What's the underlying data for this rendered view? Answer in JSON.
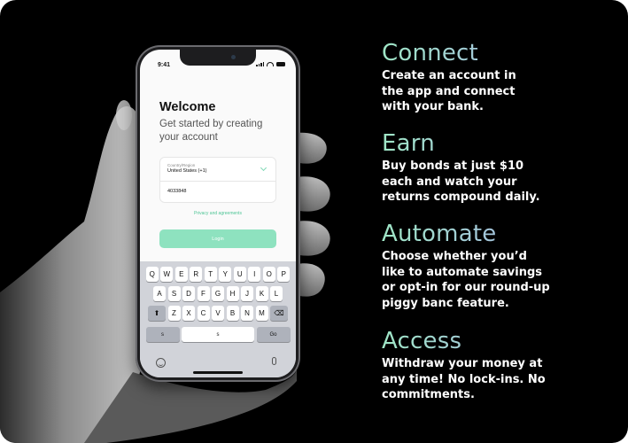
{
  "phone": {
    "status_time": "9:41",
    "welcome_title": "Welcome",
    "welcome_subtitle": "Get started by creating your account",
    "country_label": "Country/Region",
    "country_value": "United States (+1)",
    "phone_value": "4033848",
    "privacy_link": "Privacy and agreements",
    "login_label": "Login",
    "keyboard": {
      "row1": [
        "Q",
        "W",
        "E",
        "R",
        "T",
        "Y",
        "U",
        "I",
        "O",
        "P"
      ],
      "row2": [
        "A",
        "S",
        "D",
        "F",
        "G",
        "H",
        "J",
        "K",
        "L"
      ],
      "row3": [
        "Z",
        "X",
        "C",
        "V",
        "B",
        "N",
        "M"
      ],
      "shift_glyph": "⬆",
      "delete_glyph": "⌫",
      "left_key": "s",
      "space_key": "s",
      "go_key": "Go"
    }
  },
  "features": [
    {
      "title": "Connect",
      "text": "Create an account in the app and connect with your bank."
    },
    {
      "title": "Earn",
      "text": "Buy bonds at just $10 each and watch your returns compound daily."
    },
    {
      "title": "Automate",
      "text": "Choose whether you’d like to automate savings or opt-in for our round-up piggy banc feature."
    },
    {
      "title": "Access",
      "text": "Withdraw your money at any time! No lock-ins. No commitments."
    }
  ],
  "colors": {
    "background": "#000000",
    "accent_green": "#8ee2bf",
    "gradient_start": "#9fe6c6",
    "gradient_end": "#a99ff2"
  }
}
